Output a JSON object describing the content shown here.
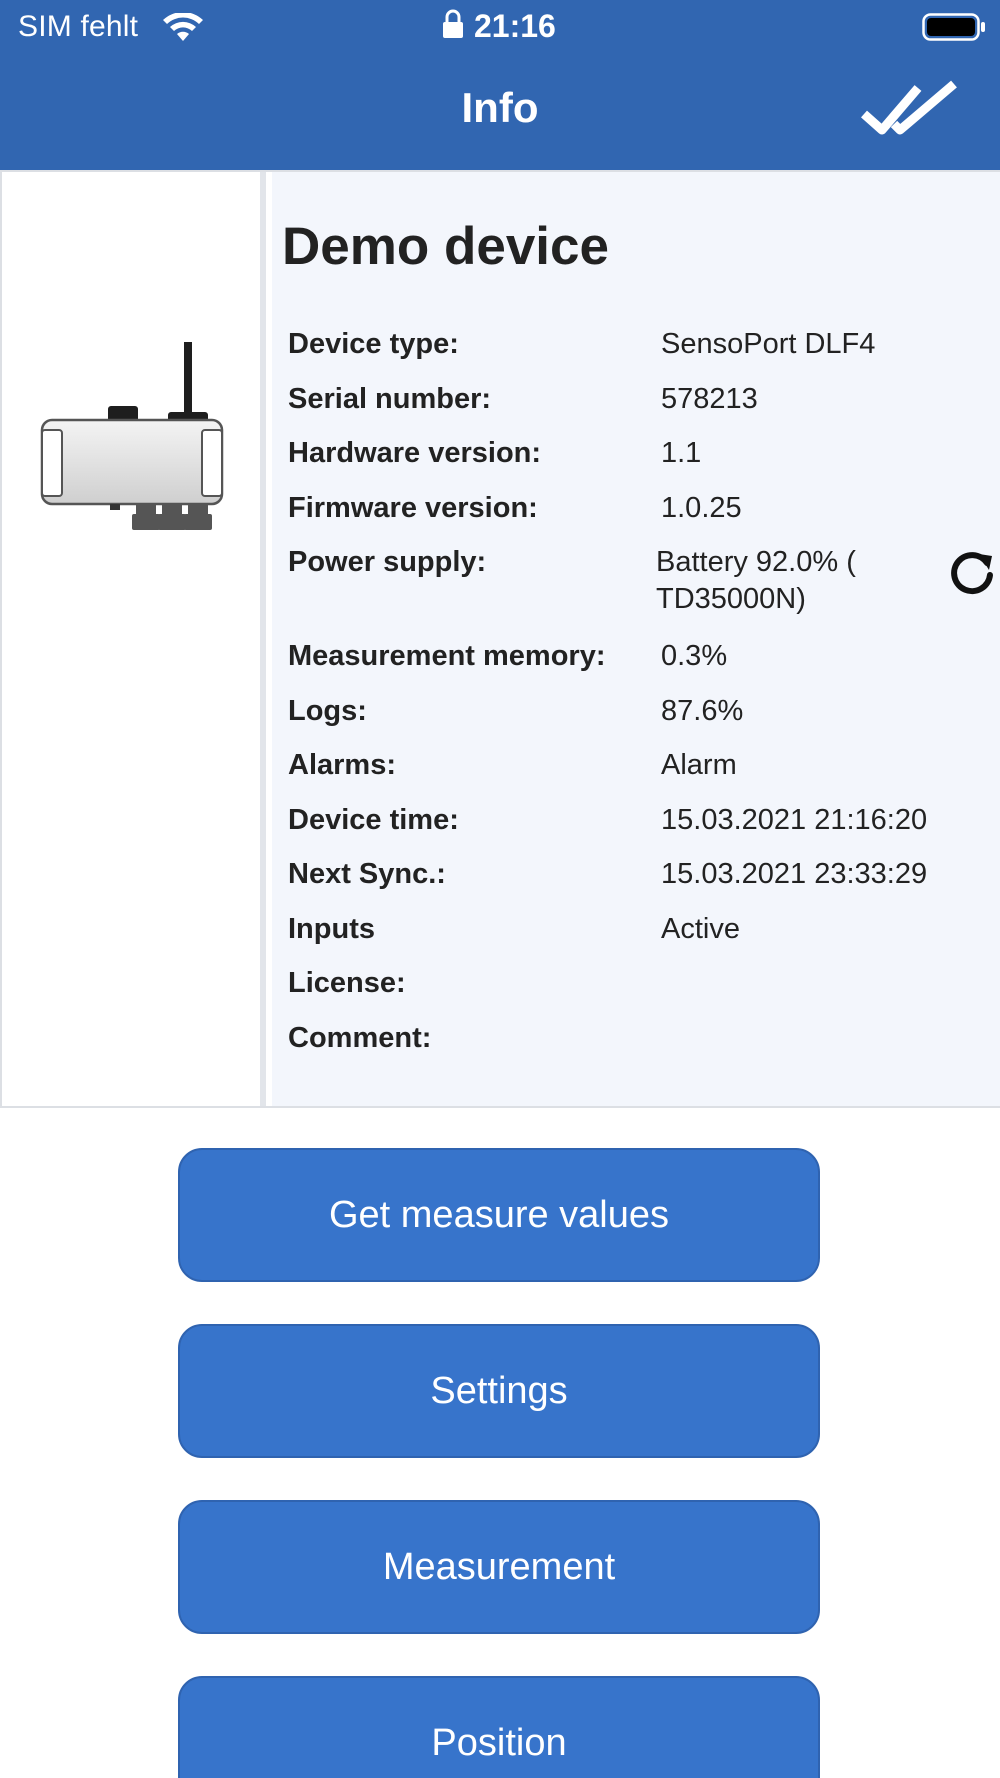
{
  "status_bar": {
    "carrier": "SIM fehlt",
    "time": "21:16"
  },
  "nav": {
    "title": "Info"
  },
  "device": {
    "title": "Demo device",
    "rows": [
      {
        "label": "Device type:",
        "value": "SensoPort DLF4"
      },
      {
        "label": "Serial number:",
        "value": "578213"
      },
      {
        "label": "Hardware version:",
        "value": "1.1"
      },
      {
        "label": "Firmware version:",
        "value": "1.0.25"
      },
      {
        "label": "Power supply:",
        "value": "Battery 92.0% ( TD35000N)"
      },
      {
        "label": "Measurement memory:",
        "value": "0.3%"
      },
      {
        "label": "Logs:",
        "value": "87.6%"
      },
      {
        "label": "Alarms:",
        "value": "Alarm"
      },
      {
        "label": "Device time:",
        "value": "15.03.2021 21:16:20"
      },
      {
        "label": "Next Sync.:",
        "value": "15.03.2021 23:33:29"
      },
      {
        "label": "Inputs",
        "value": "Active"
      },
      {
        "label": "License:",
        "value": ""
      },
      {
        "label": "Comment:",
        "value": ""
      }
    ]
  },
  "buttons": {
    "get_measure_values": "Get measure values",
    "settings": "Settings",
    "measurement": "Measurement",
    "position": "Position"
  },
  "icons": {
    "wifi": "wifi-icon",
    "lock": "lock-icon",
    "battery": "battery-icon",
    "confirm": "double-check-icon",
    "refresh": "refresh-icon",
    "device": "device-image"
  },
  "colors": {
    "nav_bar": "#3166b1",
    "button": "#3774cb",
    "panel_info_bg": "#f3f6fc"
  }
}
